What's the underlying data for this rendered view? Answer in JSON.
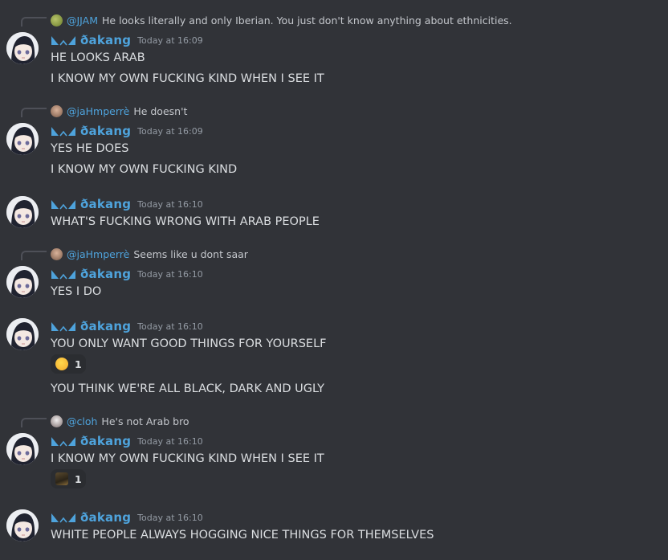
{
  "colors": {
    "background": "#313338",
    "username": "#4ea3dc",
    "mention": "#4ea3dc",
    "text": "#dbdee1",
    "timestamp": "#949ba4",
    "reaction_bg": "#2b2d31"
  },
  "messages": [
    {
      "reply": {
        "mention": "@JJAM",
        "text": "He looks literally and only Iberian. You just don't know anything about ethnicities."
      },
      "username": "ðakang",
      "timestamp": "Today at 16:09",
      "lines": [
        "HE LOOKS ARAB",
        "I KNOW MY OWN FUCKING KIND WHEN I SEE IT"
      ]
    },
    {
      "reply": {
        "mention": "@jaHmperrè",
        "text": "He doesn't"
      },
      "username": "ðakang",
      "timestamp": "Today at 16:09",
      "lines": [
        "YES HE DOES",
        "I KNOW MY OWN FUCKING KIND"
      ]
    },
    {
      "username": "ðakang",
      "timestamp": "Today at 16:10",
      "lines": [
        "WHAT'S FUCKING WRONG WITH ARAB PEOPLE"
      ]
    },
    {
      "reply": {
        "mention": "@jaHmperrè",
        "text": "Seems like u dont saar"
      },
      "username": "ðakang",
      "timestamp": "Today at 16:10",
      "lines": [
        "YES I DO"
      ]
    },
    {
      "username": "ðakang",
      "timestamp": "Today at 16:10",
      "lines": [
        "YOU ONLY WANT GOOD THINGS FOR YOURSELF",
        "YOU THINK WE'RE ALL BLACK, DARK AND UGLY"
      ],
      "reaction": {
        "emoji": "rolling-on-floor-laughing-emoji",
        "count": "1"
      }
    },
    {
      "reply": {
        "mention": "@cloh",
        "text": "He's not Arab bro"
      },
      "username": "ðakang",
      "timestamp": "Today at 16:10",
      "lines": [
        "I KNOW MY OWN FUCKING KIND WHEN I SEE IT"
      ],
      "reaction": {
        "emoji": "custom-character-emoji",
        "count": "1"
      }
    },
    {
      "username": "ðakang",
      "timestamp": "Today at 16:10",
      "lines": [
        "WHITE PEOPLE ALWAYS HOGGING NICE THINGS FOR THEMSELVES"
      ]
    }
  ]
}
